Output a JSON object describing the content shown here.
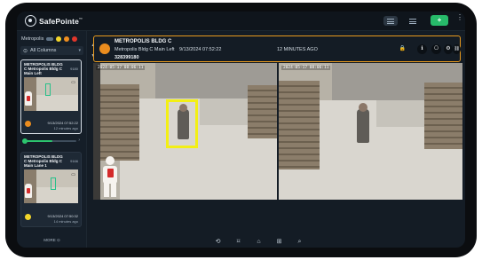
{
  "app": {
    "name": "SafePointe",
    "trademark": "™"
  },
  "topbar": {
    "add_label": "+",
    "more_label": "⋮",
    "icons": [
      "logo-icon",
      "grid-view-icon",
      "list-view-icon",
      "add-icon",
      "kebab-icon"
    ]
  },
  "sidebar": {
    "site_name": "Metropolis",
    "status_dot_colors": [
      "#f3d62a",
      "#ef8e20",
      "#e2362b"
    ],
    "filter_label": "All Columns",
    "slider_end": "›",
    "cards": [
      {
        "title": "METROPOLIS BLDG C Metropolis Bldg C Main Left",
        "code": "9180",
        "time": "9/13/2024 07:52:22",
        "ago": "12 minutes ago",
        "status_color": "#ea8c1e"
      },
      {
        "title": "METROPOLIS BLDG C Metropolis Bldg C Main Lane 1",
        "code": "9166",
        "time": "9/13/2024 07:50:32",
        "ago": "14 minutes ago",
        "status_color": "#f3d62a"
      }
    ],
    "more_label": "MORE"
  },
  "alert": {
    "building": "METROPOLIS BLDG C",
    "camera": "Metropolis Bldg C Main Left",
    "time": "9/13/2024 07:52:22",
    "ago": "12 MINUTES AGO",
    "id": "328399180",
    "status_color": "#ea8c1e",
    "border_color": "#e99a1d",
    "prev_label": "▲",
    "next_label": "▼",
    "actions": [
      "lock-icon",
      "info-icon",
      "bookmark-icon",
      "settings-icon",
      "link-icon"
    ],
    "action_glyphs": [
      "🔒",
      "ℹ",
      "⎔",
      "⚙",
      "⛓"
    ]
  },
  "videos": {
    "left_timestamp": "2024-05-17  08:06:11",
    "right_timestamp": "2024-05-17  08:06:11",
    "detection_box_color": "#f3ef14"
  },
  "bottombar": {
    "icons": [
      "history-icon",
      "bookmark-icon",
      "home-icon",
      "grid-icon",
      "search-icon"
    ],
    "glyphs": [
      "⟲",
      "⌑",
      "⌂",
      "⊞",
      "⌕"
    ]
  }
}
